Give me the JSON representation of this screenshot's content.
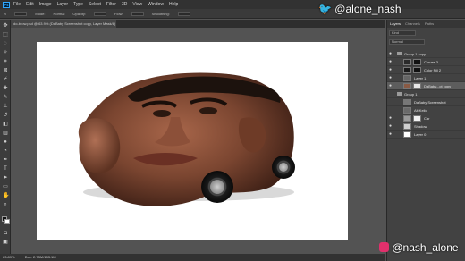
{
  "app": {
    "logo_text": "Ps",
    "menu": [
      "File",
      "Edit",
      "Image",
      "Layer",
      "Type",
      "Select",
      "Filter",
      "3D",
      "View",
      "Window",
      "Help"
    ]
  },
  "options_bar": {
    "items": [
      "Mode:",
      "Normal",
      "Opacity:",
      "Flow:",
      "Smoothing:"
    ]
  },
  "document_tab": {
    "label": "do-brow.psd @ 63.9% (DaBaby Screenshot copy, Layer Mask/8)"
  },
  "status_bar": {
    "zoom": "63.89%",
    "doc_size": "Doc: 2.73M/183.1M"
  },
  "layers_panel": {
    "tabs": [
      "Layers",
      "Channels",
      "Paths"
    ],
    "kind_label": "Kind",
    "blend_mode": "Normal",
    "layers": [
      {
        "name": "Group 1 copy",
        "type": "group",
        "visible": true
      },
      {
        "name": "Curves 3",
        "type": "adjustment",
        "visible": true
      },
      {
        "name": "Color Fill 2",
        "type": "adjustment",
        "visible": true
      },
      {
        "name": "Layer 1",
        "type": "pixel",
        "visible": true
      },
      {
        "name": "DaBaby...ot copy",
        "type": "pixel",
        "visible": true,
        "selected": true
      },
      {
        "name": "Group 1",
        "type": "group",
        "visible": false
      },
      {
        "name": "DaBaby Screenshot",
        "type": "pixel",
        "visible": false
      },
      {
        "name": "Alt Kelic",
        "type": "pixel",
        "visible": false
      },
      {
        "name": "Car",
        "type": "pixel",
        "visible": true
      },
      {
        "name": "Shadow",
        "type": "pixel",
        "visible": true
      },
      {
        "name": "Layer 0",
        "type": "pixel",
        "visible": true
      }
    ]
  },
  "watermarks": {
    "twitter": "@alone_nash",
    "instagram": "@nash_alone"
  },
  "colors": {
    "twitter_blue": "#1da1f2",
    "instagram_pink": "#e1306c"
  }
}
